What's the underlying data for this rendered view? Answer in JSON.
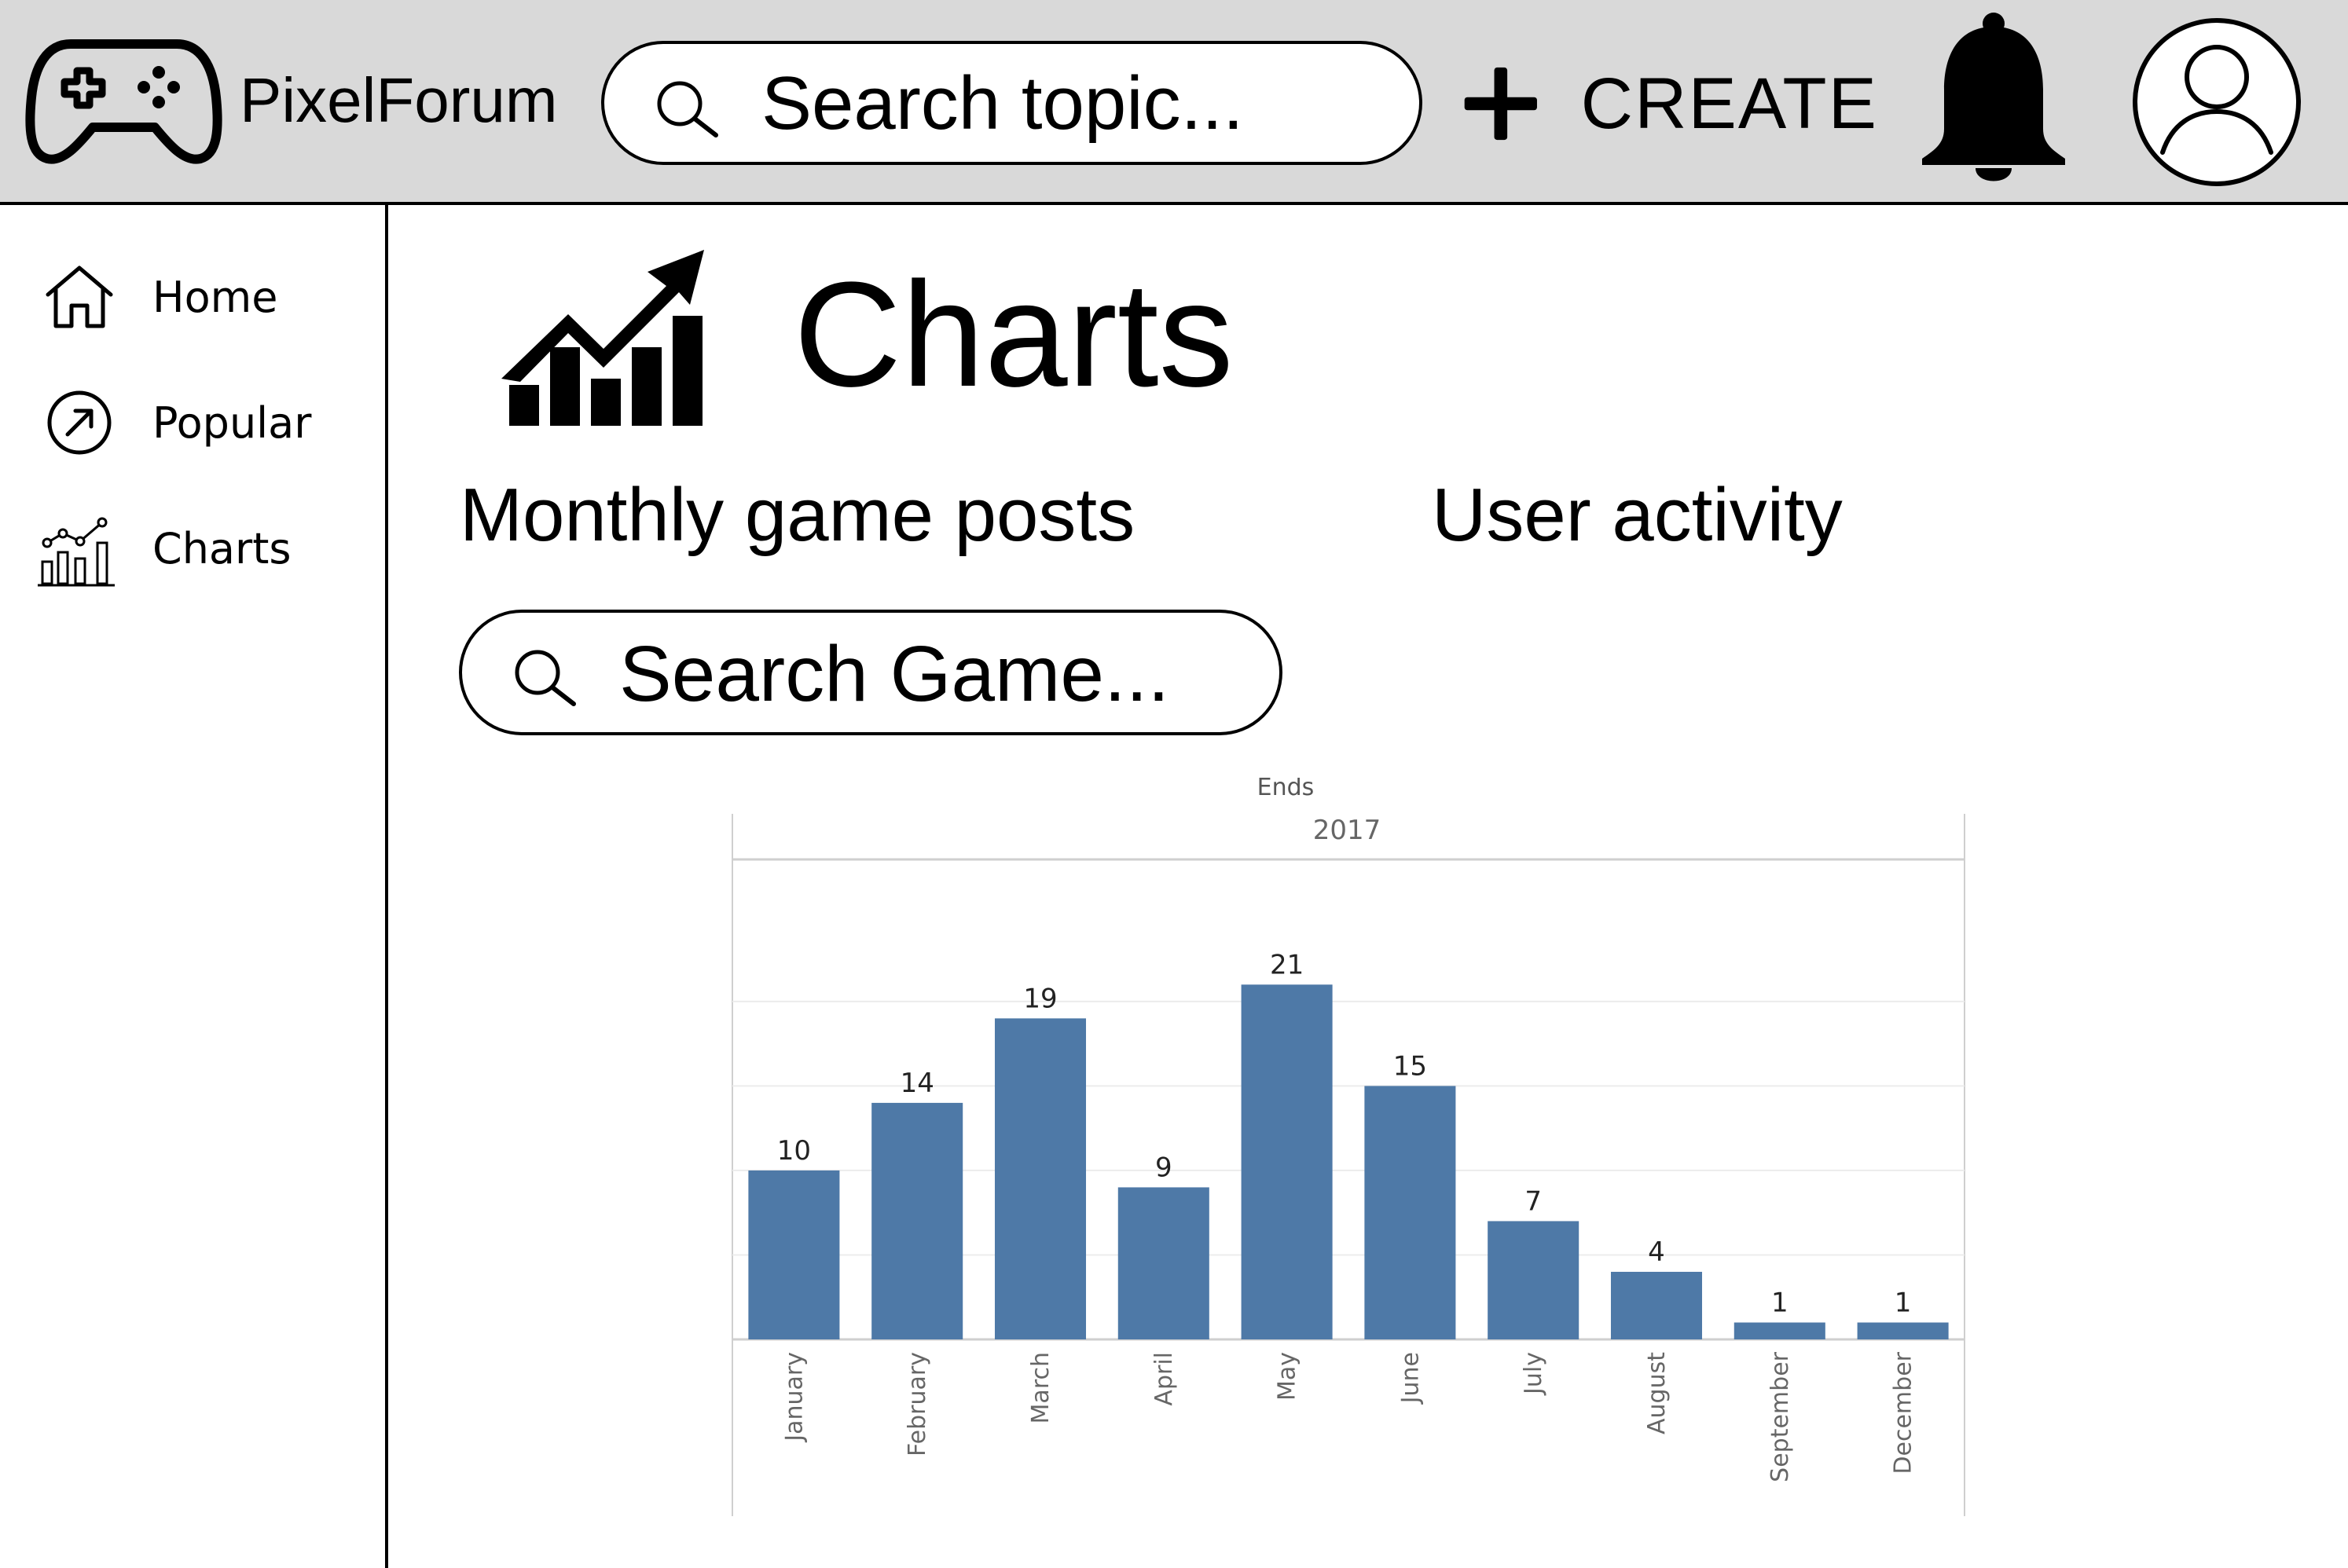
{
  "header": {
    "brand": "PixelForum",
    "search_placeholder": "Search topic...",
    "create_label": "CREATE",
    "icons": {
      "logo": "gamepad-icon",
      "search": "search-icon",
      "create": "plus-icon",
      "notifications": "bell-icon",
      "profile": "user-icon"
    }
  },
  "sidebar": {
    "items": [
      {
        "label": "Home",
        "icon": "home-icon"
      },
      {
        "label": "Popular",
        "icon": "trending-arrow-icon"
      },
      {
        "label": "Charts",
        "icon": "chart-icon"
      }
    ]
  },
  "main": {
    "title": "Charts",
    "title_icon": "trending-chart-icon",
    "tabs": [
      {
        "label": "Monthly game posts"
      },
      {
        "label": "User activity"
      }
    ],
    "search_placeholder": "Search Game..."
  },
  "colors": {
    "topbar": "#d9d9d9",
    "bar": "#4e79a7"
  },
  "chart_data": {
    "type": "bar",
    "title": "Ends",
    "subtitle": "2017",
    "categories": [
      "January",
      "February",
      "March",
      "April",
      "May",
      "June",
      "July",
      "August",
      "September",
      "December"
    ],
    "values": [
      10,
      14,
      19,
      9,
      21,
      15,
      7,
      4,
      1,
      1
    ],
    "xlabel": "",
    "ylabel": "",
    "ylim": [
      0,
      25
    ],
    "grid": true,
    "data_labels": true
  }
}
